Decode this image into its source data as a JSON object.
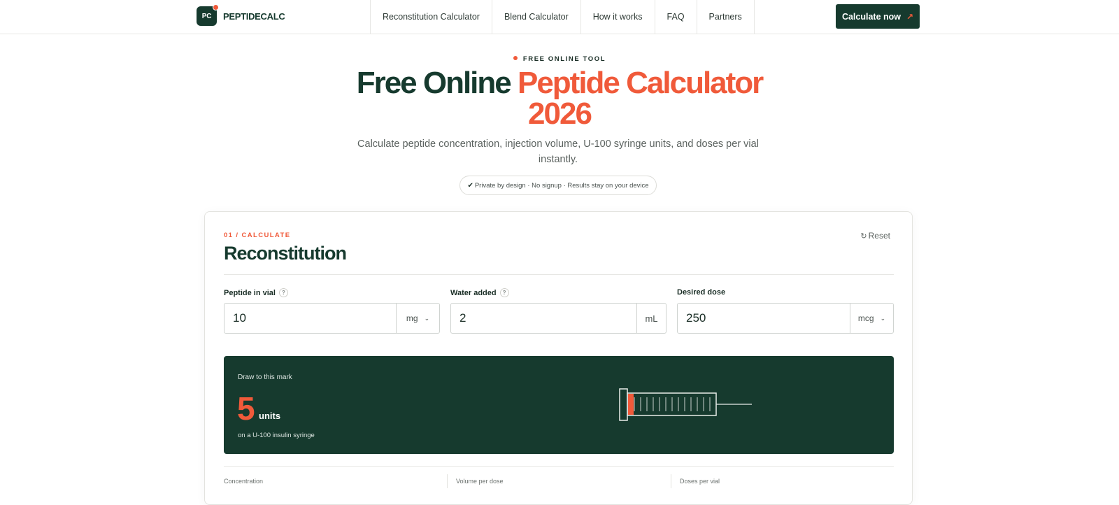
{
  "header": {
    "logo_mark": "PC",
    "logo_text": "PEPTIDECALC",
    "nav": [
      "Reconstitution Calculator",
      "Blend Calculator",
      "How it works",
      "FAQ",
      "Partners"
    ],
    "cta_label": "Calculate now",
    "cta_icon": "↗"
  },
  "hero": {
    "eyebrow": "FREE ONLINE TOOL",
    "title_part1": "Free Online ",
    "title_part2": "Peptide Calculator",
    "title_year": "2026",
    "subtitle": "Calculate peptide concentration, injection volume, U-100 syringe units, and doses per vial instantly.",
    "privacy_check": "✔",
    "privacy": "Private by design · No signup · Results stay on your device"
  },
  "calculator": {
    "step": "01 / CALCULATE",
    "title": "Reconstitution",
    "reset_icon": "↻",
    "reset_label": "Reset",
    "fields": [
      {
        "label": "Peptide in vial",
        "value": "10",
        "unit": "mg",
        "has_help": true,
        "unit_dropdown": true
      },
      {
        "label": "Water added",
        "value": "2",
        "unit": "mL",
        "has_help": true,
        "unit_dropdown": false
      },
      {
        "label": "Desired dose",
        "value": "250",
        "unit": "mcg",
        "has_help": false,
        "unit_dropdown": true
      }
    ],
    "help_icon": "?",
    "result": {
      "label": "Draw to this mark",
      "value": "5",
      "unit": "units",
      "note": "on a U-100 insulin syringe",
      "syringe_fill_fraction": 0.05
    },
    "stats": [
      "Concentration",
      "Volume per dose",
      "Doses per vial"
    ]
  },
  "colors": {
    "brand_dark": "#163a2e",
    "accent": "#f05a3a"
  }
}
